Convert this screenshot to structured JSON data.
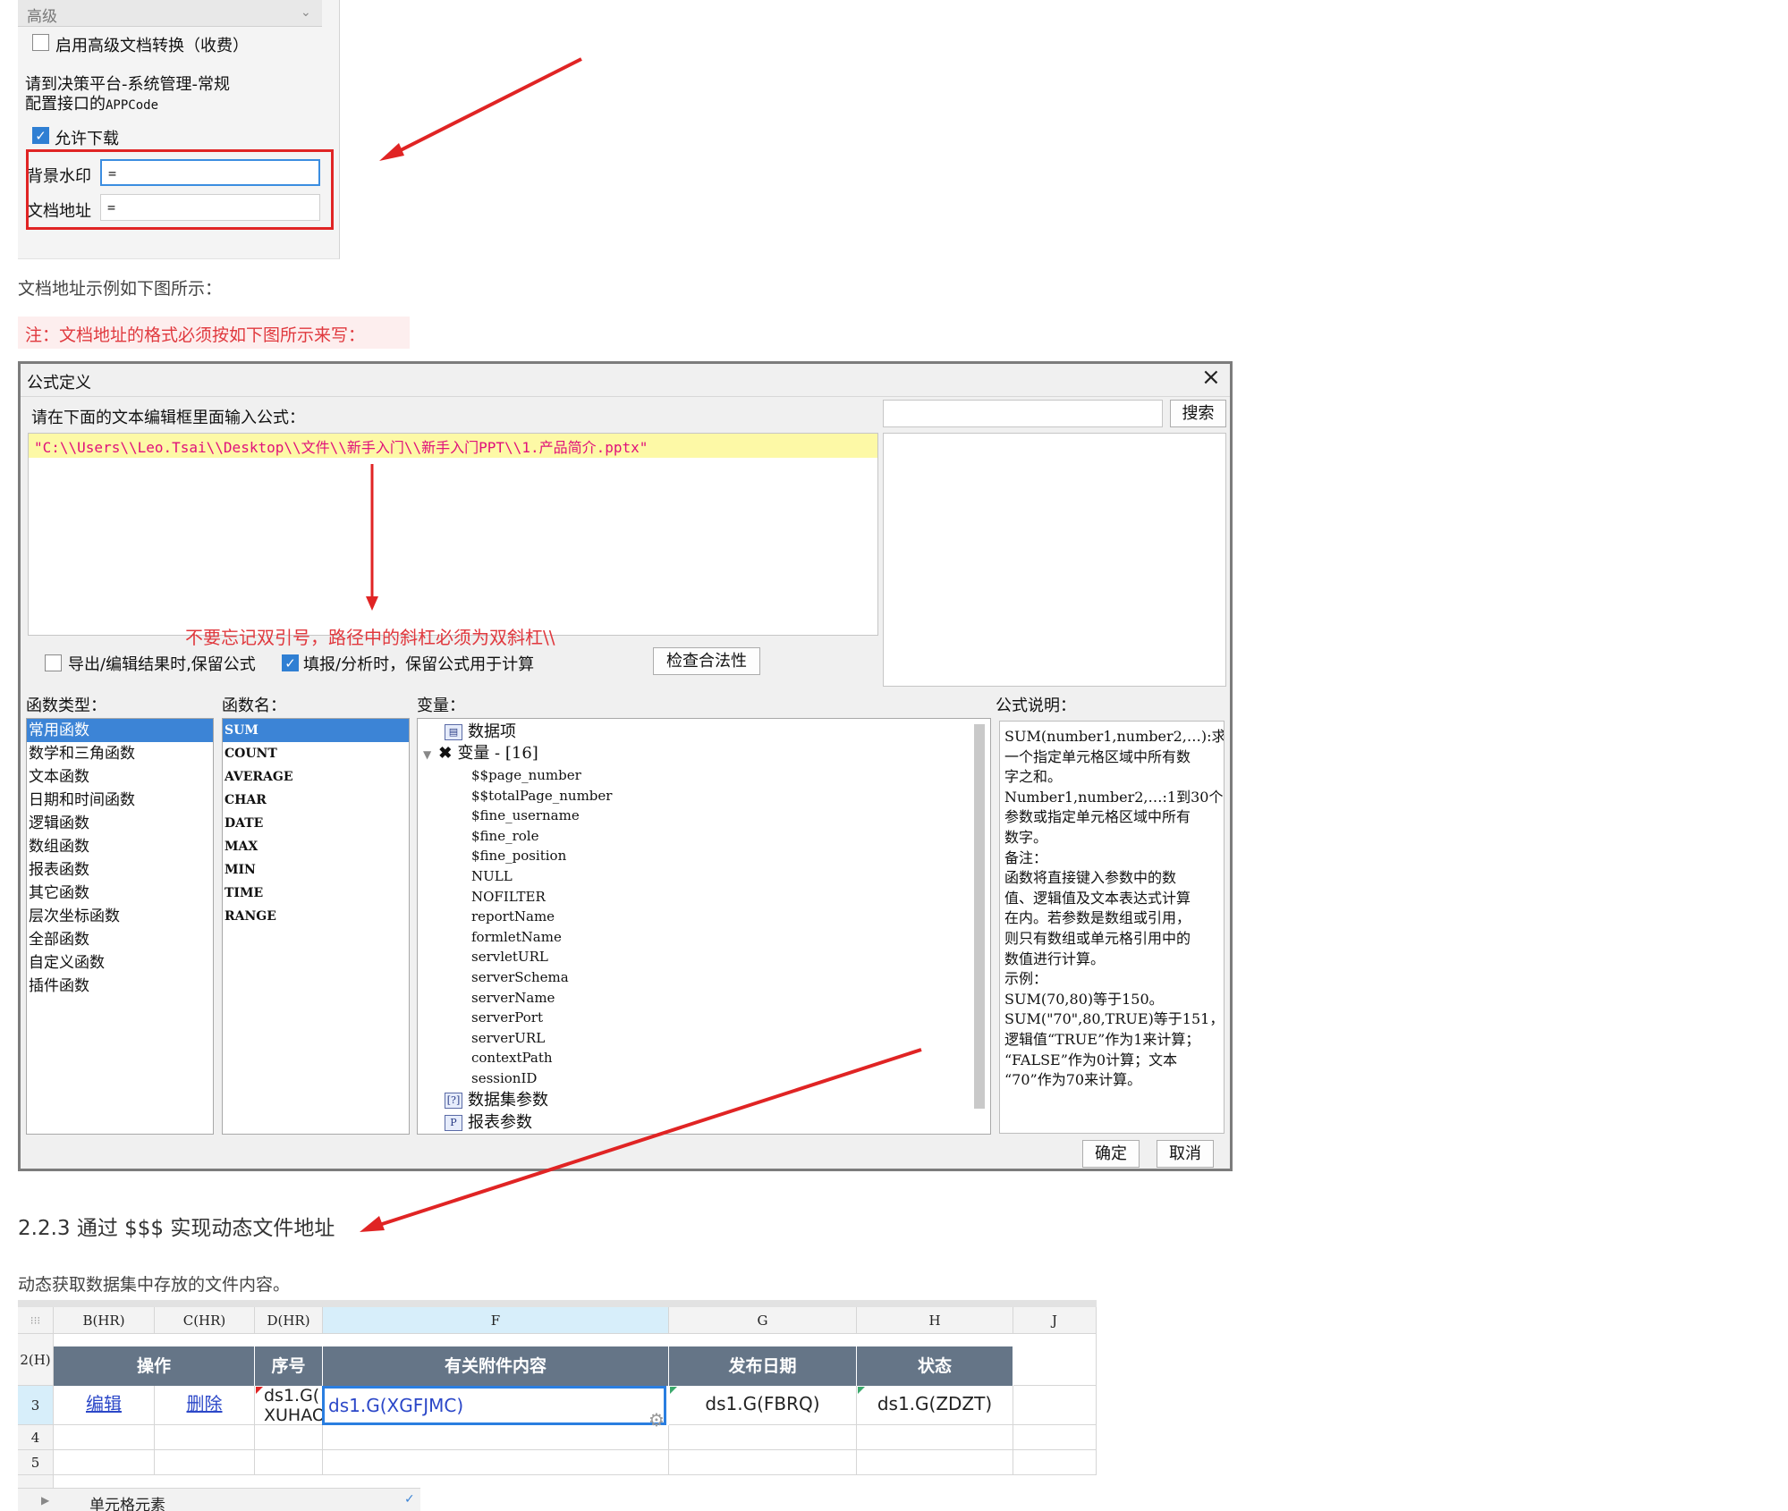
{
  "settings": {
    "section_title": "高级",
    "advanced_convert_label": "启用高级文档转换（收费）",
    "hint_line1": "请到决策平台-系统管理-常规",
    "hint_line2_prefix": "配置接口的",
    "hint_line2_code": "APPCode",
    "allow_download_label": "允许下载",
    "watermark_label": "背景水印",
    "watermark_value": "=",
    "doc_address_label": "文档地址",
    "doc_address_value": "="
  },
  "text": {
    "example_caption": "文档地址示例如下图所示：",
    "note": "注：文档地址的格式必须按如下图所示来写：",
    "section_heading": "2.2.3 通过 $$$ 实现动态文件地址",
    "section_desc": "动态获取数据集中存放的文件内容。"
  },
  "dialog": {
    "title": "公式定义",
    "prompt": "请在下面的文本编辑框里面输入公式：",
    "formula": "\"C:\\\\Users\\\\Leo.Tsai\\\\Desktop\\\\文件\\\\新手入门\\\\新手入门PPT\\\\1.产品简介.pptx\"",
    "annotation": "不要忘记双引号，路径中的斜杠必须为双斜杠\\\\",
    "search_btn": "搜索",
    "opt_export_label": "导出/编辑结果时,保留公式",
    "opt_fill_label": "填报/分析时，保留公式用于计算",
    "check_btn": "检查合法性",
    "func_type_label": "函数类型：",
    "func_name_label": "函数名：",
    "variable_label": "变量：",
    "desc_label": "公式说明：",
    "func_types": [
      "常用函数",
      "数学和三角函数",
      "文本函数",
      "日期和时间函数",
      "逻辑函数",
      "数组函数",
      "报表函数",
      "其它函数",
      "层次坐标函数",
      "全部函数",
      "自定义函数",
      "插件函数"
    ],
    "func_names": [
      "SUM",
      "COUNT",
      "AVERAGE",
      "CHAR",
      "DATE",
      "MAX",
      "MIN",
      "TIME",
      "RANGE"
    ],
    "tree": {
      "data_items": "数据项",
      "variables": "变量 - [16]",
      "vars": [
        "$$page_number",
        "$$totalPage_number",
        "$fine_username",
        "$fine_role",
        "$fine_position",
        "NULL",
        "NOFILTER",
        "reportName",
        "formletName",
        "servletURL",
        "serverSchema",
        "serverName",
        "serverPort",
        "serverURL",
        "contextPath",
        "sessionID"
      ],
      "dataset_params": "数据集参数",
      "report_params": "报表参数"
    },
    "description": [
      "SUM(number1,number2,…):求",
      "一个指定单元格区域中所有数",
      "字之和。",
      "Number1,number2,…:1到30个",
      "参数或指定单元格区域中所有",
      "数字。",
      "备注：",
      "函数将直接键入参数中的数",
      "值、逻辑值及文本表达式计算",
      "在内。若参数是数组或引用，",
      "则只有数组或单元格引用中的",
      "数值进行计算。",
      "示例：",
      "SUM(70,80)等于150。",
      "SUM(\"70\",80,TRUE)等于151，",
      "逻辑值“TRUE”作为1来计算；",
      "“FALSE”作为0计算；文本",
      "“70”作为70来计算。"
    ],
    "ok_btn": "确定",
    "cancel_btn": "取消"
  },
  "sheet": {
    "corner": "⁝⁝⁝",
    "columns": [
      "B(HR)",
      "C(HR)",
      "D(HR)",
      "F",
      "G",
      "H",
      "J"
    ],
    "rows": [
      "2(H)",
      "3",
      "4",
      "5"
    ],
    "headers": [
      "操作",
      "序号",
      "有关附件内容",
      "发布日期",
      "状态"
    ],
    "row3": {
      "edit": "编辑",
      "delete": "删除",
      "serial": "ds1.G(",
      "serial_wrap": "XUHAO",
      "attachment": "ds1.G(XGFJMC)",
      "date": "ds1.G(FBRQ)",
      "status": "ds1.G(ZDZT)"
    },
    "bottom_fragment": "单元格元素"
  },
  "colors": {
    "accent_blue": "#3c84d6",
    "annotation_red": "#e02424",
    "table_header": "#657587",
    "formula_highlight": "#fdf9a6"
  }
}
